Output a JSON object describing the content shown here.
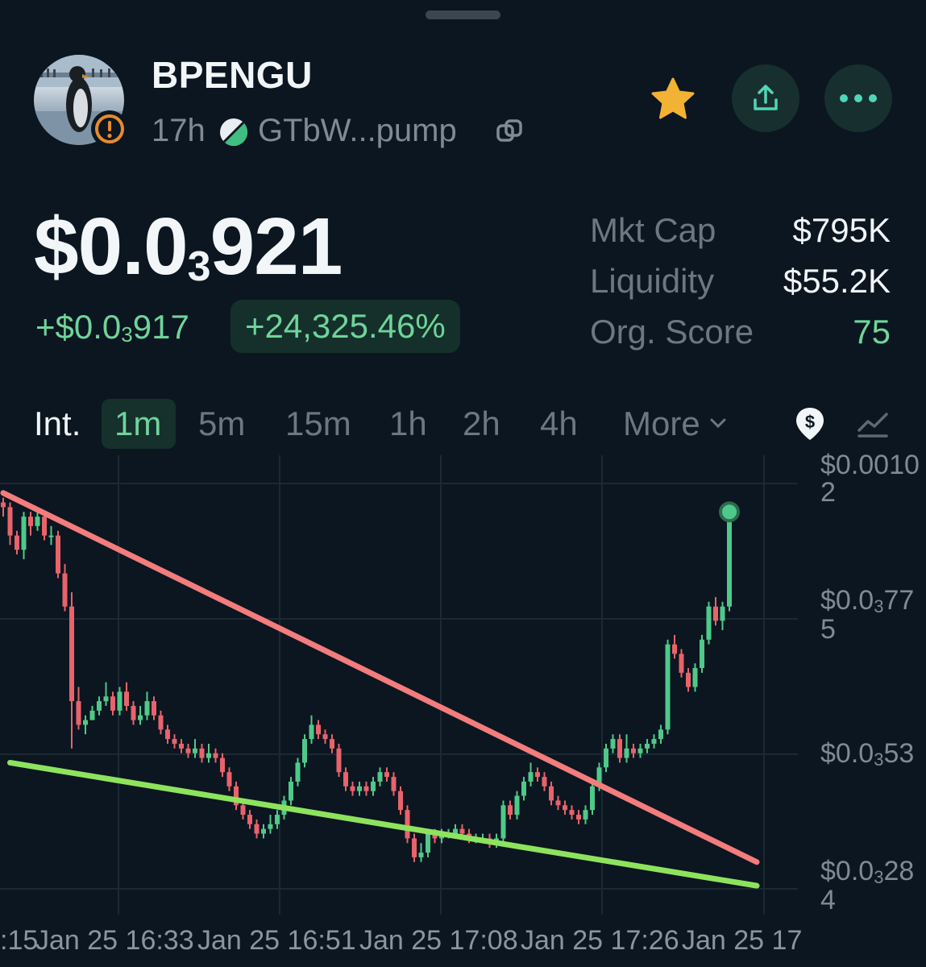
{
  "token": {
    "name": "BPENGU",
    "age": "17h",
    "address": "GTbW...pump"
  },
  "price": {
    "main": "$0.0",
    "sub": "3",
    "tail": "921",
    "change_main": "+$0.0",
    "change_sub": "3",
    "change_tail": "917",
    "change_pct": "+24,325.46%"
  },
  "stats": [
    {
      "label": "Mkt Cap",
      "value": "$795K"
    },
    {
      "label": "Liquidity",
      "value": "$55.2K"
    },
    {
      "label": "Org. Score",
      "value": "75"
    }
  ],
  "colors": {
    "background": "#0b1620",
    "up": "#4fc98a",
    "down": "#e8636b",
    "score": "#6fd49a",
    "star": "#f2b233",
    "resistance_line": "#f37c7c",
    "support_line": "#8ee35d"
  },
  "tabs": {
    "interval_label": "Int.",
    "items": [
      "1m",
      "5m",
      "15m",
      "1h",
      "2h",
      "4h"
    ],
    "active": "1m",
    "more_label": "More"
  },
  "icons": {
    "warning": "warning-icon",
    "pill": "pill-icon",
    "copy": "copy-icon",
    "star": "star-icon",
    "share": "share-icon",
    "more": "more-dots-icon",
    "price_mode": "dollar-shield-icon",
    "chart_style": "trend-line-icon"
  },
  "chart_data": {
    "type": "candlestick",
    "y_ticks": [
      {
        "main": "$0.0010",
        "wrap": "2"
      },
      {
        "main": "$0.0",
        "sub": "3",
        "tail": "77",
        "wrap": "5"
      },
      {
        "main": "$0.0",
        "sub": "3",
        "tail": "53",
        "wrap": ""
      },
      {
        "main": "$0.0",
        "sub": "3",
        "tail": "28",
        "wrap": "4"
      }
    ],
    "x_ticks": [
      ":15",
      "Jan 25 16:33",
      "Jan 25 16:51",
      "Jan 25 17:08",
      "Jan 25 17:26",
      "Jan 25 17"
    ],
    "candles": [
      [
        1.02,
        1.01,
        1.03,
        0.99
      ],
      [
        1.01,
        0.95,
        1.02,
        0.93
      ],
      [
        0.95,
        0.92,
        0.96,
        0.91
      ],
      [
        0.92,
        0.99,
        1.0,
        0.9
      ],
      [
        0.99,
        0.97,
        1.0,
        0.95
      ],
      [
        0.97,
        0.99,
        1.0,
        0.96
      ],
      [
        0.99,
        0.95,
        1.0,
        0.94
      ],
      [
        0.95,
        0.95,
        0.97,
        0.93
      ],
      [
        0.95,
        0.87,
        0.96,
        0.86
      ],
      [
        0.87,
        0.8,
        0.89,
        0.79
      ],
      [
        0.8,
        0.6,
        0.83,
        0.5
      ],
      [
        0.6,
        0.55,
        0.63,
        0.54
      ],
      [
        0.55,
        0.56,
        0.57,
        0.53
      ],
      [
        0.56,
        0.58,
        0.59,
        0.56
      ],
      [
        0.58,
        0.6,
        0.61,
        0.57
      ],
      [
        0.6,
        0.61,
        0.64,
        0.59
      ],
      [
        0.61,
        0.58,
        0.62,
        0.57
      ],
      [
        0.58,
        0.62,
        0.63,
        0.57
      ],
      [
        0.62,
        0.59,
        0.64,
        0.58
      ],
      [
        0.59,
        0.56,
        0.6,
        0.55
      ],
      [
        0.56,
        0.57,
        0.59,
        0.55
      ],
      [
        0.57,
        0.6,
        0.62,
        0.56
      ],
      [
        0.6,
        0.57,
        0.61,
        0.56
      ],
      [
        0.57,
        0.54,
        0.58,
        0.53
      ],
      [
        0.54,
        0.52,
        0.55,
        0.51
      ],
      [
        0.52,
        0.51,
        0.53,
        0.5
      ],
      [
        0.51,
        0.5,
        0.52,
        0.49
      ],
      [
        0.5,
        0.49,
        0.51,
        0.48
      ],
      [
        0.49,
        0.5,
        0.52,
        0.48
      ],
      [
        0.5,
        0.48,
        0.51,
        0.47
      ],
      [
        0.48,
        0.49,
        0.51,
        0.47
      ],
      [
        0.49,
        0.48,
        0.5,
        0.47
      ],
      [
        0.48,
        0.45,
        0.49,
        0.44
      ],
      [
        0.45,
        0.42,
        0.46,
        0.41
      ],
      [
        0.42,
        0.38,
        0.43,
        0.37
      ],
      [
        0.38,
        0.36,
        0.39,
        0.35
      ],
      [
        0.36,
        0.34,
        0.37,
        0.33
      ],
      [
        0.34,
        0.32,
        0.35,
        0.31
      ],
      [
        0.32,
        0.33,
        0.34,
        0.31
      ],
      [
        0.33,
        0.34,
        0.36,
        0.32
      ],
      [
        0.34,
        0.36,
        0.37,
        0.33
      ],
      [
        0.36,
        0.39,
        0.4,
        0.35
      ],
      [
        0.39,
        0.43,
        0.44,
        0.38
      ],
      [
        0.43,
        0.47,
        0.48,
        0.42
      ],
      [
        0.47,
        0.52,
        0.53,
        0.46
      ],
      [
        0.52,
        0.55,
        0.57,
        0.51
      ],
      [
        0.55,
        0.53,
        0.56,
        0.52
      ],
      [
        0.53,
        0.52,
        0.54,
        0.51
      ],
      [
        0.52,
        0.5,
        0.53,
        0.49
      ],
      [
        0.5,
        0.45,
        0.51,
        0.44
      ],
      [
        0.45,
        0.42,
        0.46,
        0.41
      ],
      [
        0.42,
        0.41,
        0.43,
        0.4
      ],
      [
        0.41,
        0.42,
        0.43,
        0.4
      ],
      [
        0.42,
        0.41,
        0.43,
        0.4
      ],
      [
        0.41,
        0.43,
        0.44,
        0.4
      ],
      [
        0.43,
        0.45,
        0.46,
        0.42
      ],
      [
        0.45,
        0.44,
        0.46,
        0.43
      ],
      [
        0.44,
        0.41,
        0.45,
        0.4
      ],
      [
        0.41,
        0.37,
        0.42,
        0.36
      ],
      [
        0.37,
        0.31,
        0.38,
        0.3
      ],
      [
        0.31,
        0.27,
        0.32,
        0.26
      ],
      [
        0.27,
        0.28,
        0.3,
        0.26
      ],
      [
        0.28,
        0.32,
        0.33,
        0.27
      ],
      [
        0.32,
        0.31,
        0.33,
        0.3
      ],
      [
        0.31,
        0.32,
        0.33,
        0.3
      ],
      [
        0.32,
        0.32,
        0.33,
        0.31
      ],
      [
        0.32,
        0.33,
        0.34,
        0.31
      ],
      [
        0.33,
        0.32,
        0.34,
        0.31
      ],
      [
        0.32,
        0.31,
        0.33,
        0.3
      ],
      [
        0.31,
        0.31,
        0.32,
        0.3
      ],
      [
        0.31,
        0.31,
        0.32,
        0.3
      ],
      [
        0.31,
        0.3,
        0.32,
        0.29
      ],
      [
        0.3,
        0.31,
        0.32,
        0.29
      ],
      [
        0.31,
        0.38,
        0.39,
        0.3
      ],
      [
        0.38,
        0.36,
        0.39,
        0.35
      ],
      [
        0.36,
        0.4,
        0.41,
        0.35
      ],
      [
        0.4,
        0.43,
        0.44,
        0.39
      ],
      [
        0.43,
        0.45,
        0.47,
        0.42
      ],
      [
        0.45,
        0.44,
        0.46,
        0.43
      ],
      [
        0.44,
        0.42,
        0.45,
        0.41
      ],
      [
        0.42,
        0.39,
        0.43,
        0.38
      ],
      [
        0.39,
        0.38,
        0.4,
        0.37
      ],
      [
        0.38,
        0.37,
        0.39,
        0.36
      ],
      [
        0.37,
        0.36,
        0.38,
        0.35
      ],
      [
        0.36,
        0.35,
        0.37,
        0.34
      ],
      [
        0.35,
        0.37,
        0.38,
        0.34
      ],
      [
        0.37,
        0.42,
        0.43,
        0.36
      ],
      [
        0.42,
        0.46,
        0.47,
        0.41
      ],
      [
        0.46,
        0.5,
        0.51,
        0.45
      ],
      [
        0.5,
        0.52,
        0.53,
        0.49
      ],
      [
        0.52,
        0.48,
        0.53,
        0.47
      ],
      [
        0.48,
        0.5,
        0.53,
        0.47
      ],
      [
        0.5,
        0.49,
        0.51,
        0.48
      ],
      [
        0.49,
        0.5,
        0.51,
        0.48
      ],
      [
        0.5,
        0.51,
        0.52,
        0.49
      ],
      [
        0.51,
        0.52,
        0.53,
        0.5
      ],
      [
        0.52,
        0.54,
        0.55,
        0.51
      ],
      [
        0.54,
        0.72,
        0.73,
        0.53
      ],
      [
        0.72,
        0.7,
        0.74,
        0.69
      ],
      [
        0.7,
        0.66,
        0.71,
        0.65
      ],
      [
        0.66,
        0.63,
        0.67,
        0.62
      ],
      [
        0.63,
        0.67,
        0.68,
        0.62
      ],
      [
        0.67,
        0.73,
        0.74,
        0.66
      ],
      [
        0.73,
        0.8,
        0.81,
        0.72
      ],
      [
        0.8,
        0.77,
        0.82,
        0.76
      ],
      [
        0.77,
        0.8,
        0.81,
        0.75
      ],
      [
        0.8,
        1.0,
        1.0,
        0.79
      ]
    ],
    "last_price_marker": 1.0,
    "trendlines": [
      {
        "name": "resistance",
        "from": [
          0,
          1.04
        ],
        "to": [
          110,
          0.26
        ]
      },
      {
        "name": "support",
        "from": [
          1,
          0.47
        ],
        "to": [
          110,
          0.21
        ]
      }
    ]
  }
}
